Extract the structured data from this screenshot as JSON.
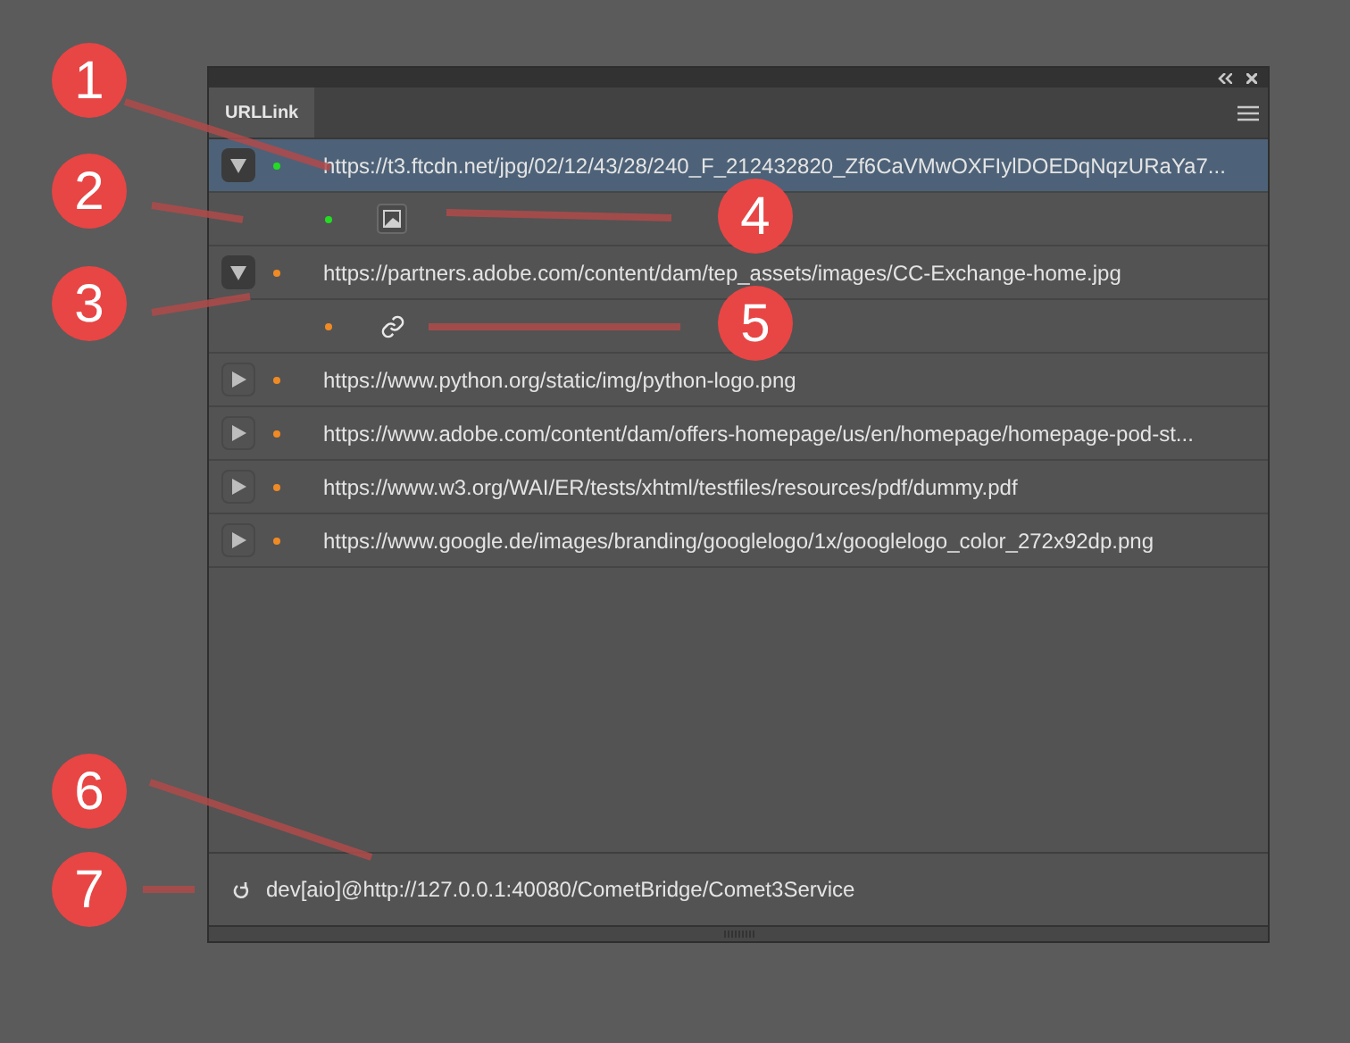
{
  "panel": {
    "tab": {
      "label": "URLLink",
      "selected": true
    }
  },
  "rows": [
    {
      "url": "https://t3.ftcdn.net/jpg/02/12/43/28/240_F_212432820_Zf6CaVMwOXFIylDOEDqNqzURaYa7...",
      "color": "#22dd22",
      "expanded": true,
      "selected": true,
      "children": [
        {
          "color": "#22dd22",
          "kind": "image"
        }
      ]
    },
    {
      "url": "https://partners.adobe.com/content/dam/tep_assets/images/CC-Exchange-home.jpg",
      "color": "#f08a24",
      "expanded": true,
      "selected": false,
      "children": [
        {
          "color": "#f08a24",
          "kind": "link"
        }
      ]
    },
    {
      "url": "https://www.python.org/static/img/python-logo.png",
      "color": "#f08a24",
      "expanded": false,
      "selected": false
    },
    {
      "url": "https://www.adobe.com/content/dam/offers-homepage/us/en/homepage/homepage-pod-st...",
      "color": "#f08a24",
      "expanded": false,
      "selected": false
    },
    {
      "url": "https://www.w3.org/WAI/ER/tests/xhtml/testfiles/resources/pdf/dummy.pdf",
      "color": "#f08a24",
      "expanded": false,
      "selected": false
    },
    {
      "url": "https://www.google.de/images/branding/googlelogo/1x/googlelogo_color_272x92dp.png",
      "color": "#f08a24",
      "expanded": false,
      "selected": false
    }
  ],
  "status": {
    "connection": "dev[aio]@http://127.0.0.1:40080/CometBridge/Comet3Service"
  },
  "callouts": [
    {
      "number": "1"
    },
    {
      "number": "2"
    },
    {
      "number": "4"
    },
    {
      "number": "3"
    },
    {
      "number": "5"
    },
    {
      "number": "6"
    },
    {
      "number": "7"
    }
  ]
}
